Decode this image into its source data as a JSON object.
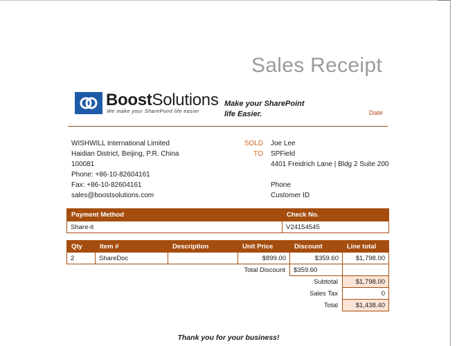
{
  "header": {
    "title": "Sales Receipt",
    "logo_name_bold": "Boost",
    "logo_name_rest": "Solutions",
    "logo_tagline": "We make your SharePoint life easier",
    "slogan_line1": "Make your SharePoint",
    "slogan_line2": "life Easier.",
    "date_label": "Date"
  },
  "company": {
    "name": "WISHWILL International Limited",
    "address": "Haidian District, Beijing, P.R. China",
    "postcode": "100081",
    "phone": "Phone: +86-10-82604161",
    "fax": "Fax: +86-10-82604161",
    "email": "sales@boostsolutions.com"
  },
  "sold_to": {
    "label_sold": "SOLD",
    "label_to": "TO",
    "name": "Joe Lee",
    "company": "SPField",
    "address": "4401 Freidrich Lane | Bldg 2 Suite 200",
    "phone_label": "Phone",
    "customer_id_label": "Customer ID"
  },
  "payment": {
    "col_method": "Payment Method",
    "col_check": "Check No.",
    "method": "Share-it",
    "check_no": "V24154545"
  },
  "items": {
    "columns": [
      "Qty",
      "Item #",
      "Description",
      "Unit Price",
      "Discount",
      "Line total"
    ],
    "rows": [
      {
        "qty": "2",
        "item": "ShareDoc",
        "description": "",
        "unit_price": "$899.00",
        "discount": "$359.60",
        "line_total": "$1,798.00"
      }
    ],
    "total_discount_label": "Total Discount",
    "total_discount": "$359.60",
    "subtotal_label": "Subtotal",
    "subtotal": "$1,798.00",
    "sales_tax_label": "Sales Tax",
    "sales_tax": "0",
    "total_label": "Total",
    "total": "$1,438.40"
  },
  "footer": {
    "thanks": "Thank you for your business!"
  },
  "colors": {
    "accent_brown": "#a54d0e",
    "accent_orange": "#d0611e",
    "shade": "#fbe4d5",
    "logo_blue": "#1f5ca8"
  }
}
